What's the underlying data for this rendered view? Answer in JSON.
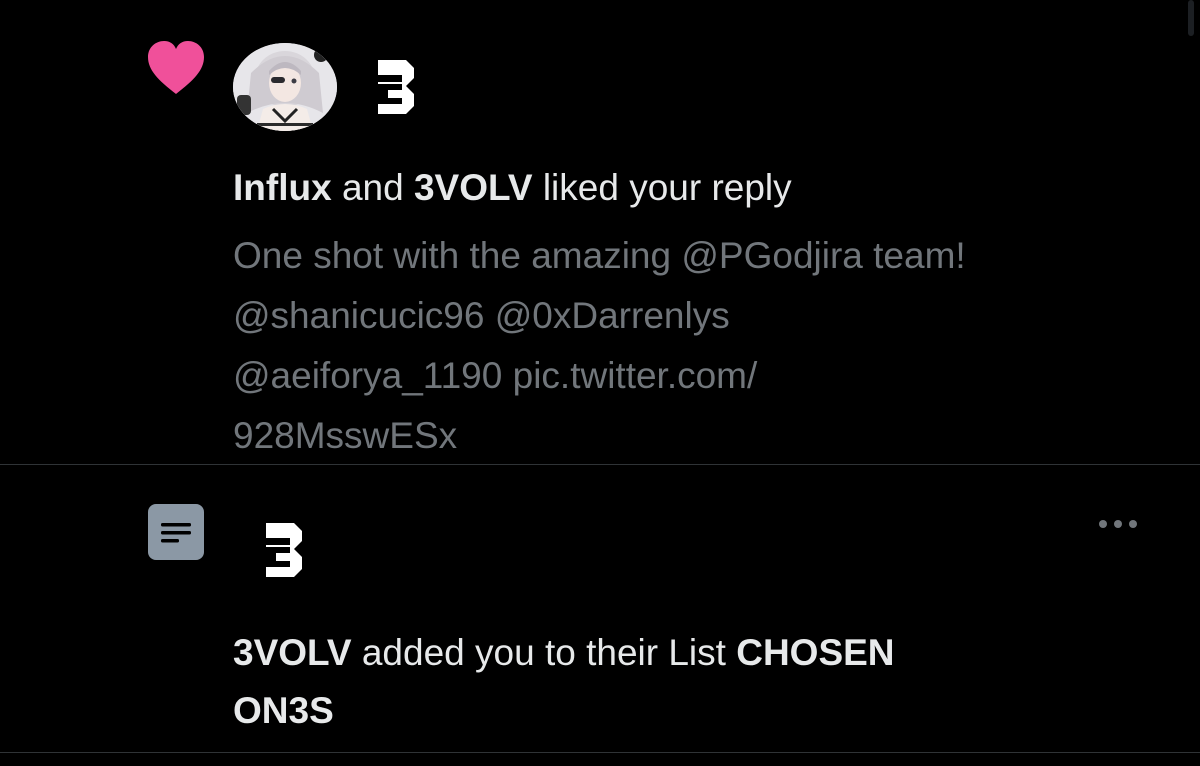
{
  "like_notification": {
    "icon": "heart-icon",
    "user1": "Influx",
    "connector": " and ",
    "user2": "3VOLV",
    "action": " liked your reply",
    "reply_lines": [
      "One shot with the amazing @PGodjira team!",
      "@shanicucic96 @0xDarrenlys",
      "@aeiforya_1190 pic.twitter.com/",
      "928MsswESx"
    ]
  },
  "list_notification": {
    "icon": "list-icon",
    "user": "3VOLV",
    "action": " added you to their List ",
    "list_name_line1": "CHOSEN",
    "list_name_line2": "ON3S"
  },
  "colors": {
    "background": "#000000",
    "heart": "#f0509a",
    "text_primary": "#e7e9ea",
    "text_secondary": "#71767b",
    "divider": "#2f3336",
    "list_icon_bg": "#8b98a5"
  }
}
